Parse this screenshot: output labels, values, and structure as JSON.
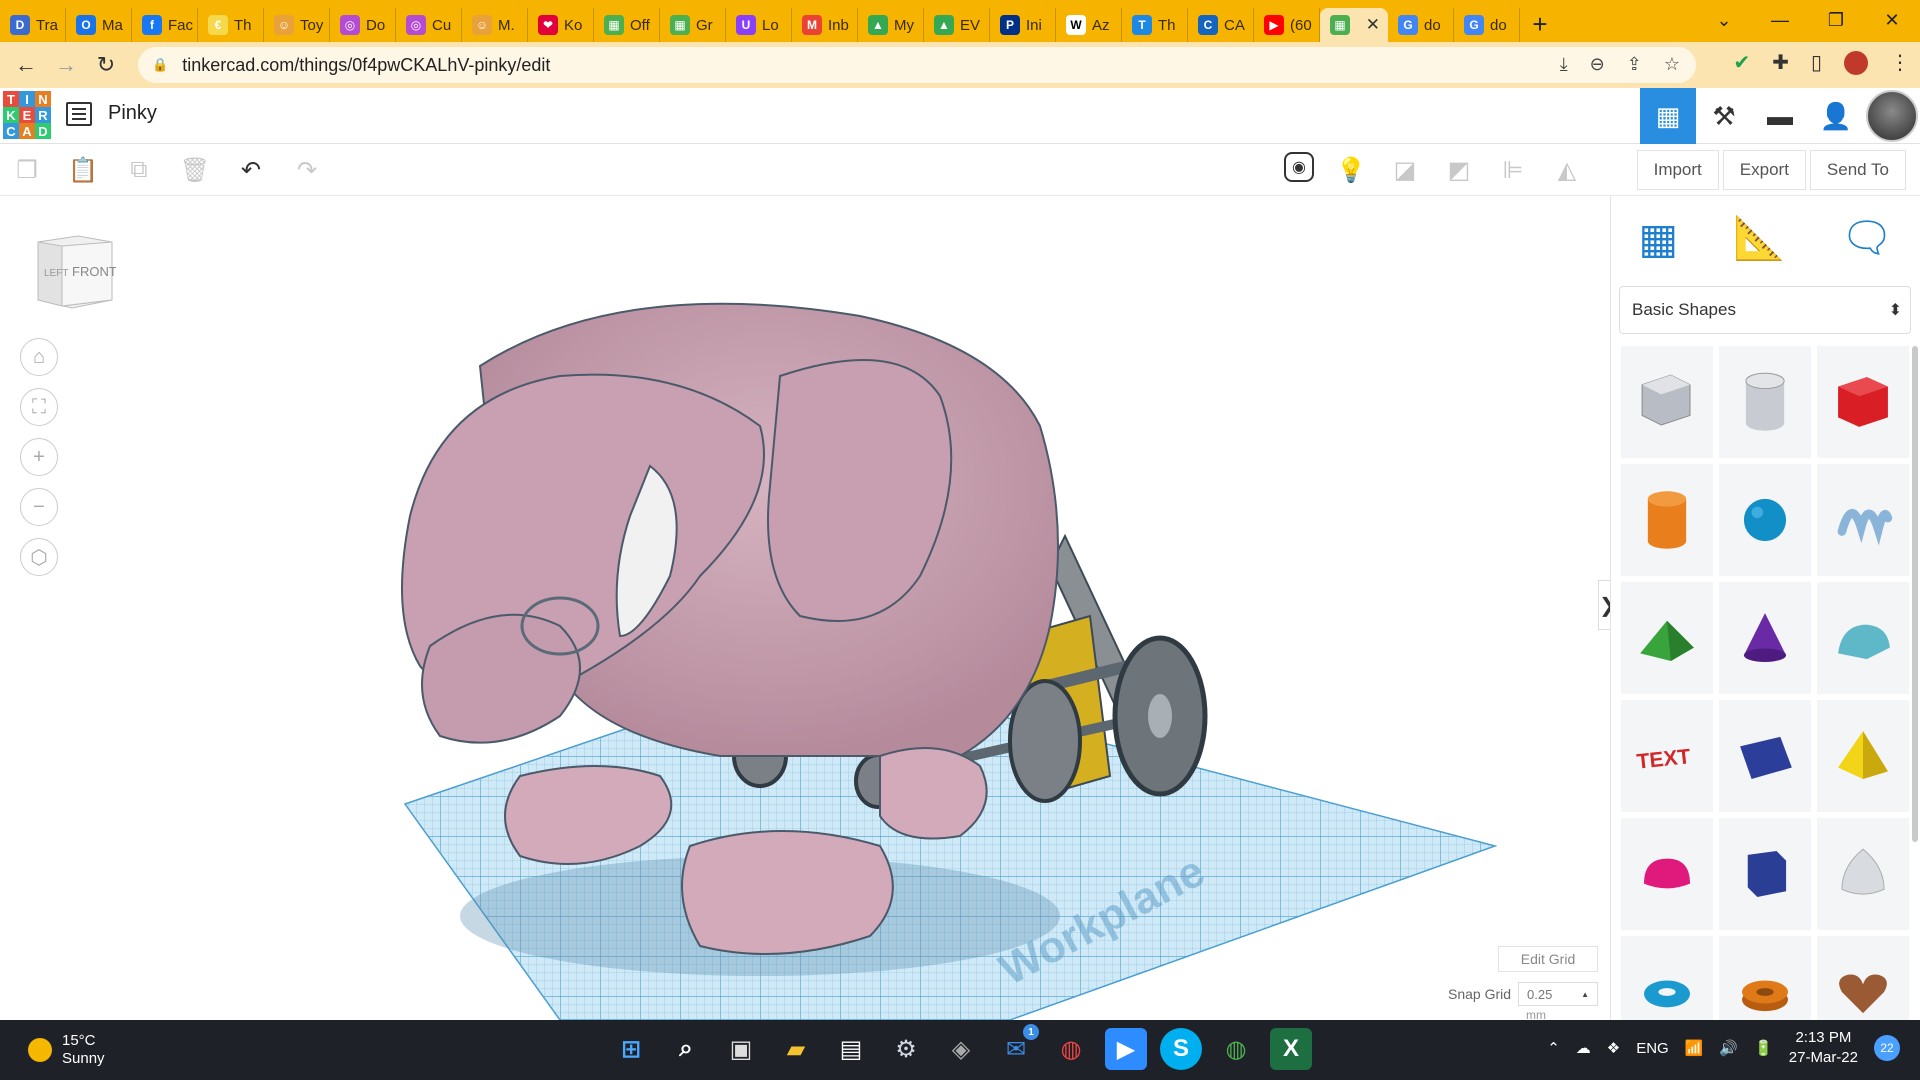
{
  "browser": {
    "tabs": [
      {
        "label": "Tra",
        "color": "#3b6ad1",
        "glyph": "D"
      },
      {
        "label": "Ma",
        "color": "#1a73e8",
        "glyph": "O"
      },
      {
        "label": "Fac",
        "color": "#1877f2",
        "glyph": "f"
      },
      {
        "label": "Th",
        "color": "#f6d94a",
        "glyph": "€"
      },
      {
        "label": "Toy",
        "color": "#e9a23b",
        "glyph": "☺"
      },
      {
        "label": "Do",
        "color": "#b44bd3",
        "glyph": "◎"
      },
      {
        "label": "Cu",
        "color": "#b44bd3",
        "glyph": "◎"
      },
      {
        "label": "M.",
        "color": "#e9a23b",
        "glyph": "☺"
      },
      {
        "label": "Ko",
        "color": "#e1003c",
        "glyph": "❤"
      },
      {
        "label": "Off",
        "color": "#4caf50",
        "glyph": "▦"
      },
      {
        "label": "Gr",
        "color": "#4caf50",
        "glyph": "▦"
      },
      {
        "label": "Lo",
        "color": "#8a3ffc",
        "glyph": "U"
      },
      {
        "label": "Inb",
        "color": "#ea4335",
        "glyph": "M"
      },
      {
        "label": "My",
        "color": "#34a853",
        "glyph": "▲"
      },
      {
        "label": "EV",
        "color": "#34a853",
        "glyph": "▲"
      },
      {
        "label": "Ini",
        "color": "#003087",
        "glyph": "P"
      },
      {
        "label": "Az",
        "color": "#ffffff",
        "glyph": "W"
      },
      {
        "label": "Th",
        "color": "#1e88e5",
        "glyph": "T"
      },
      {
        "label": "CA",
        "color": "#1565c0",
        "glyph": "C"
      },
      {
        "label": "(60",
        "color": "#ff0000",
        "glyph": "▶"
      },
      {
        "label": "",
        "color": "#4caf50",
        "glyph": "▦",
        "active": true
      },
      {
        "label": "do",
        "color": "#4285f4",
        "glyph": "G"
      },
      {
        "label": "do",
        "color": "#4285f4",
        "glyph": "G"
      }
    ],
    "url": "tinkercad.com/things/0f4pwCKALhV-pinky/edit"
  },
  "tinkercad": {
    "logo_letters": [
      "T",
      "I",
      "N",
      "K",
      "E",
      "R",
      "C",
      "A",
      "D"
    ],
    "logo_colors": [
      "#e74c3c",
      "#3498db",
      "#e67e22",
      "#2ecc71",
      "#e74c3c",
      "#3498db",
      "#3498db",
      "#e67e22",
      "#2ecc71"
    ],
    "design_name": "Pinky",
    "actions": {
      "import": "Import",
      "export": "Export",
      "send_to": "Send To"
    },
    "viewcube": {
      "left": "LEFT",
      "front": "FRONT"
    },
    "edit_grid": "Edit Grid",
    "snap_grid_label": "Snap Grid",
    "snap_grid_value": "0.25",
    "snap_grid_unit": "mm",
    "shape_library": "Basic Shapes",
    "plane_watermark": "Workplane",
    "shapes": [
      {
        "name": "box-hole",
        "color": "#b8bcc4"
      },
      {
        "name": "cylinder-hole",
        "color": "#c8ccd2"
      },
      {
        "name": "box",
        "color": "#d91e26"
      },
      {
        "name": "cylinder",
        "color": "#e87e1c"
      },
      {
        "name": "sphere",
        "color": "#138fc7"
      },
      {
        "name": "scribble",
        "color": "#8ab4d8"
      },
      {
        "name": "roof",
        "color": "#3aa43c"
      },
      {
        "name": "cone",
        "color": "#6a2aa6"
      },
      {
        "name": "round-roof",
        "color": "#5fb8c8"
      },
      {
        "name": "text",
        "color": "#d02828"
      },
      {
        "name": "wedge",
        "color": "#2b3f9a"
      },
      {
        "name": "pyramid",
        "color": "#f2d418"
      },
      {
        "name": "half-sphere",
        "color": "#e0197d"
      },
      {
        "name": "polygon",
        "color": "#2a3e96"
      },
      {
        "name": "paraboloid",
        "color": "#d8dbe0"
      },
      {
        "name": "torus",
        "color": "#1b9ad0"
      },
      {
        "name": "tube",
        "color": "#e07a18"
      },
      {
        "name": "heart",
        "color": "#9a5a34"
      }
    ]
  },
  "taskbar": {
    "temperature": "15°C",
    "condition": "Sunny",
    "language": "ENG",
    "time": "2:13 PM",
    "date": "27-Mar-22",
    "notifications": "22",
    "mail_badge": "1"
  }
}
